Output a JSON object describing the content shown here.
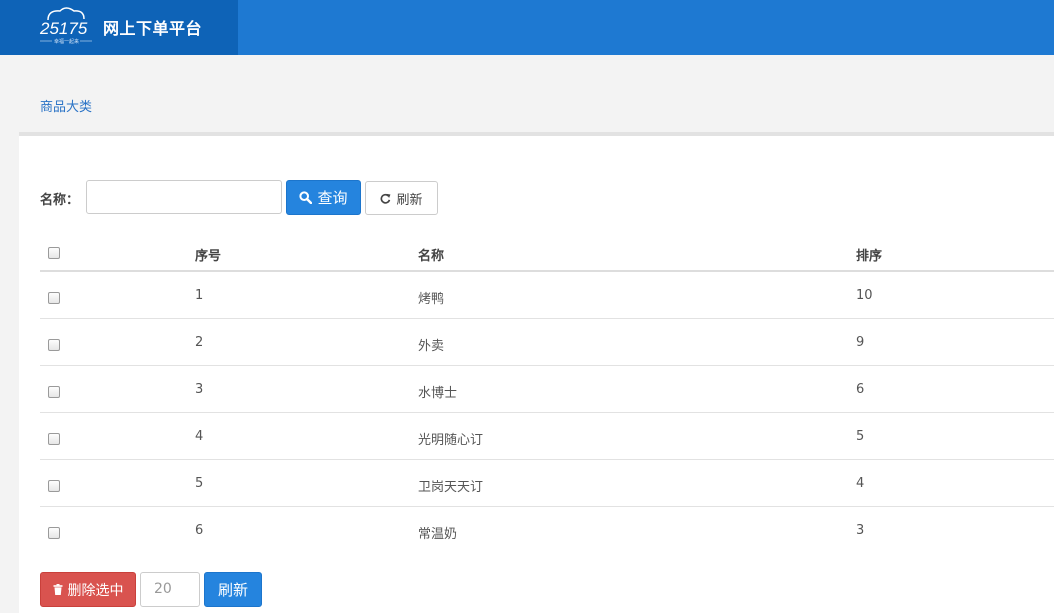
{
  "header": {
    "logo_text": "25175",
    "logo_tagline": "幸福一起来",
    "title": "网上下单平台"
  },
  "breadcrumb": "商品大类",
  "search": {
    "label": "名称：",
    "value": "",
    "query_label": "查询",
    "refresh_label": "刷新"
  },
  "table": {
    "columns": [
      "序号",
      "名称",
      "排序"
    ],
    "rows": [
      {
        "no": "1",
        "name": "烤鸭",
        "sort": "10"
      },
      {
        "no": "2",
        "name": "外卖",
        "sort": "9"
      },
      {
        "no": "3",
        "name": "水博士",
        "sort": "6"
      },
      {
        "no": "4",
        "name": "光明随心订",
        "sort": "5"
      },
      {
        "no": "5",
        "name": "卫岗天天订",
        "sort": "4"
      },
      {
        "no": "6",
        "name": "常温奶",
        "sort": "3"
      }
    ]
  },
  "footer": {
    "delete_label": "删除选中",
    "page_size": "20",
    "refresh_label": "刷新"
  },
  "icons": {
    "query": "search-icon",
    "refresh": "refresh-icon",
    "delete": "trash-icon"
  },
  "colors": {
    "header_bg": "#1e79d2",
    "brand_bg": "#0e63b7",
    "primary": "#2584de",
    "danger": "#d9534f",
    "link": "#2a73c6"
  }
}
